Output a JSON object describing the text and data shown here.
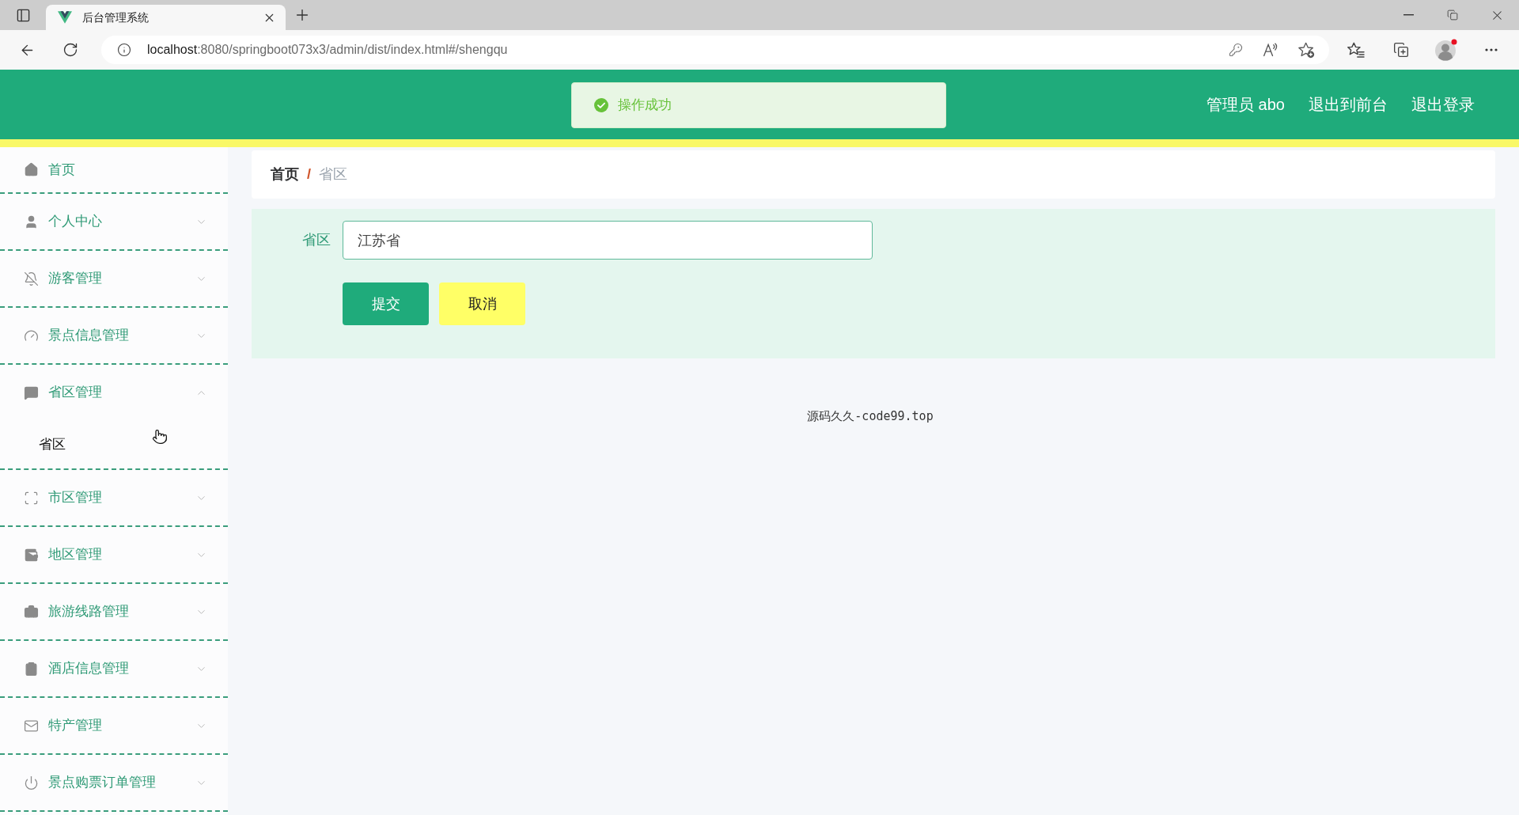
{
  "browser": {
    "tab": {
      "title": "后台管理系统"
    },
    "address": {
      "host": "localhost",
      "path": ":8080/springboot073x3/admin/dist/index.html#/shengqu"
    }
  },
  "header": {
    "toast": {
      "kind": "success",
      "message": "操作成功"
    },
    "links": [
      "管理员 abo",
      "退出到前台",
      "退出登录"
    ]
  },
  "sidebar": {
    "items": [
      {
        "kind": "link",
        "label": "首页"
      },
      {
        "kind": "submenu",
        "label": "个人中心",
        "expanded": false
      },
      {
        "kind": "submenu",
        "label": "游客管理",
        "expanded": false
      },
      {
        "kind": "submenu",
        "label": "景点信息管理",
        "expanded": false
      },
      {
        "kind": "submenu",
        "label": "省区管理",
        "expanded": true,
        "children": [
          {
            "label": "省区"
          }
        ]
      },
      {
        "kind": "submenu",
        "label": "市区管理",
        "expanded": false
      },
      {
        "kind": "submenu",
        "label": "地区管理",
        "expanded": false
      },
      {
        "kind": "submenu",
        "label": "旅游线路管理",
        "expanded": false
      },
      {
        "kind": "submenu",
        "label": "酒店信息管理",
        "expanded": false
      },
      {
        "kind": "submenu",
        "label": "特产管理",
        "expanded": false
      },
      {
        "kind": "submenu",
        "label": "景点购票订单管理",
        "expanded": false
      }
    ]
  },
  "breadcrumb": {
    "items": [
      "首页",
      "省区"
    ],
    "separator": "/"
  },
  "form": {
    "fields": [
      {
        "label": "省区",
        "value": "江苏省"
      }
    ],
    "buttons": [
      {
        "kind": "primary",
        "label": "提交"
      },
      {
        "kind": "cancel",
        "label": "取消"
      }
    ]
  },
  "footer": "源码久久-code99.top"
}
